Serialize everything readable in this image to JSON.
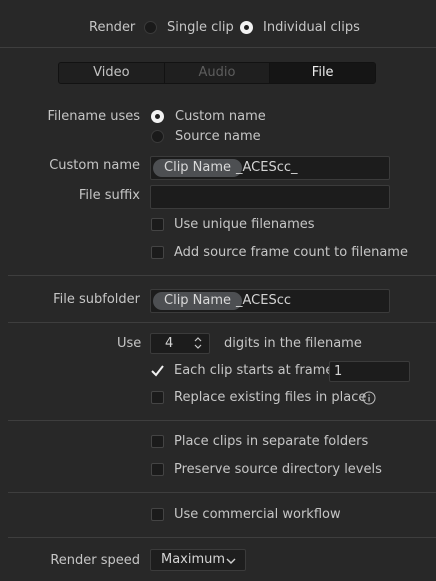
{
  "render": {
    "label": "Render",
    "options": [
      "Single clip",
      "Individual clips"
    ],
    "selected": "Individual clips"
  },
  "tabs": [
    {
      "label": "Video",
      "state": "normal"
    },
    {
      "label": "Audio",
      "state": "disabled"
    },
    {
      "label": "File",
      "state": "active"
    }
  ],
  "filename_uses": {
    "label": "Filename uses",
    "options": [
      "Custom name",
      "Source name"
    ],
    "selected": "Custom name"
  },
  "custom_name": {
    "label": "Custom name",
    "chip": "Clip Name",
    "suffix_text": "_ACEScc_"
  },
  "file_suffix": {
    "label": "File suffix",
    "value": ""
  },
  "checks_a": [
    {
      "label": "Use unique filenames",
      "checked": false
    },
    {
      "label": "Add source frame count to filename",
      "checked": false
    }
  ],
  "file_subfolder": {
    "label": "File subfolder",
    "chip": "Clip Name",
    "suffix_text": "_ACEScc"
  },
  "digits": {
    "label": "Use",
    "value": "4",
    "after": "digits in the filename"
  },
  "each_clip": {
    "label": "Each clip starts at frame",
    "checked": true,
    "value": "1"
  },
  "replace": {
    "label": "Replace existing files in place",
    "checked": false,
    "info_icon": "info-icon"
  },
  "checks_b": [
    {
      "label": "Place clips in separate folders",
      "checked": false
    },
    {
      "label": "Preserve source directory levels",
      "checked": false
    }
  ],
  "commercial": {
    "label": "Use commercial workflow",
    "checked": false
  },
  "render_speed": {
    "label": "Render speed",
    "value": "Maximum"
  },
  "colors": {
    "background": "#282828",
    "field": "#1c1c1c",
    "chip": "#4d4f52",
    "separator": "#3e3e3e"
  }
}
